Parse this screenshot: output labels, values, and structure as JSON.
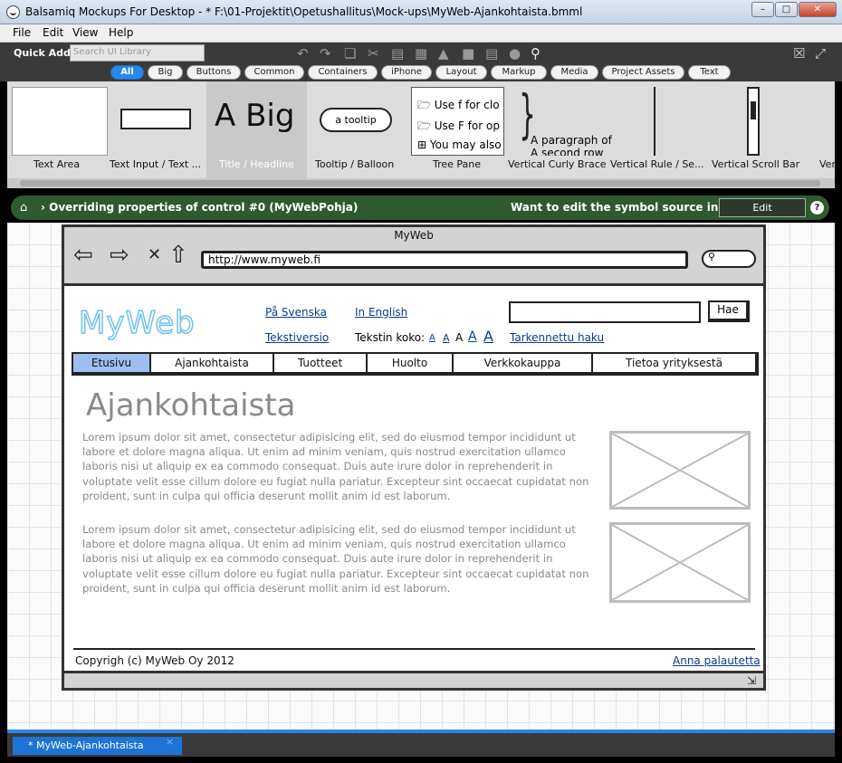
{
  "window": {
    "title": "Balsamiq Mockups For Desktop - * F:\\01-Projektit\\Opetushallitus\\Mock-ups\\MyWeb-Ajankohtaista.bmml"
  },
  "menu": [
    "File",
    "Edit",
    "View",
    "Help"
  ],
  "quick_add": {
    "label": "Quick Add:",
    "placeholder": "Search UI Library"
  },
  "categories": [
    "All",
    "Big",
    "Buttons",
    "Common",
    "Containers",
    "iPhone",
    "Layout",
    "Markup",
    "Media",
    "Project Assets",
    "Text"
  ],
  "ui_library": {
    "labels": [
      "Text Area",
      "Text Input / Text ...",
      "Title / Headline",
      "Tooltip / Balloon",
      "Tree Pane",
      "Vertical Curly Brace",
      "Vertical Rule / Se...",
      "Vertical Scroll Bar",
      "Ver"
    ],
    "big_title_text": "A Big",
    "tooltip_text": "a tooltip",
    "tree_items": [
      "Use f for clo",
      "Use F for op",
      "You may also"
    ],
    "paragraph_lines": [
      "A paragraph of",
      "A second row"
    ]
  },
  "override_bar": {
    "text": "› Overriding properties of control #0 (MyWebPohja)",
    "question": "Want to edit the symbol source instead?",
    "edit_label": "Edit",
    "help": "?"
  },
  "mockup": {
    "browser_title": "MyWeb",
    "url": "http://www.myweb.fi",
    "logo": "MyWeb",
    "links": {
      "swedish": "På Svenska",
      "english": "In English",
      "text_version": "Tekstiversio",
      "advanced_search": "Tarkennettu haku"
    },
    "font_size_label": "Tekstin koko:",
    "font_sizes": [
      "A",
      "A",
      "A",
      "A",
      "A"
    ],
    "search_button": "Hae",
    "tabs": [
      "Etusivu",
      "Ajankohtaista",
      "Tuotteet",
      "Huolto",
      "Verkkokauppa",
      "Tietoa yrityksestä"
    ],
    "active_tab": "Etusivu",
    "heading": "Ajankohtaista",
    "paragraphs": [
      "Lorem ipsum dolor sit amet, consectetur adipisicing elit, sed do eiusmod tempor incididunt ut labore et dolore magna aliqua. Ut enim ad minim veniam, quis nostrud exercitation ullamco laboris nisi ut aliquip ex ea commodo consequat. Duis aute irure dolor in reprehenderit in voluptate velit esse cillum dolore eu fugiat nulla pariatur. Excepteur sint occaecat cupidatat non proident, sunt in culpa qui officia deserunt mollit anim id est laborum.",
      "Lorem ipsum dolor sit amet, consectetur adipisicing elit, sed do eiusmod tempor incididunt ut labore et dolore magna aliqua. Ut enim ad minim veniam, quis nostrud exercitation ullamco laboris nisi ut aliquip ex ea commodo consequat. Duis aute irure dolor in reprehenderit in voluptate velit esse cillum dolore eu fugiat nulla pariatur. Excepteur sint occaecat cupidatat non proident, sunt in culpa qui officia deserunt mollit anim id est laborum."
    ],
    "copyright": "Copyrigh (c) MyWeb Oy  2012",
    "feedback": "Anna palautetta"
  },
  "document_tab": {
    "label": "* MyWeb-Ajankohtaista",
    "close": "×"
  },
  "colors": {
    "accent": "#2a86e8",
    "override_bar": "#2f5a2f",
    "active_tab": "#9ebfee",
    "logo": "#6fc2ec"
  }
}
